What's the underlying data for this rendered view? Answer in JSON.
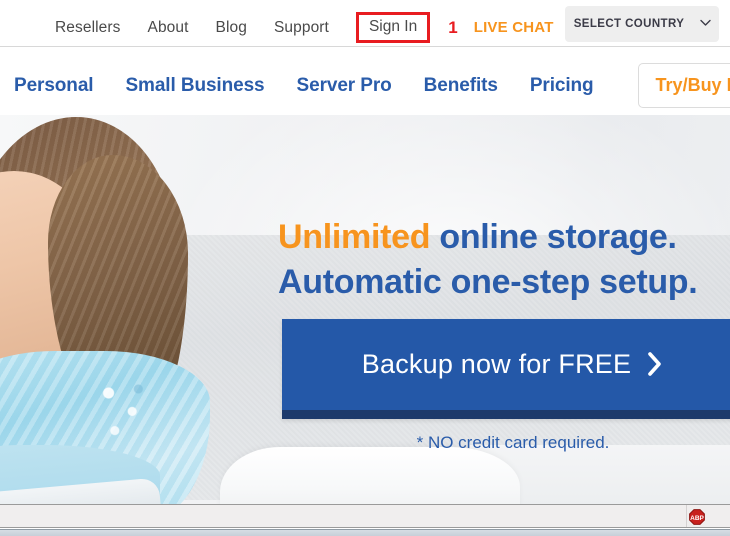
{
  "utility_bar": {
    "links": [
      {
        "label": "Resellers"
      },
      {
        "label": "About"
      },
      {
        "label": "Blog"
      },
      {
        "label": "Support"
      }
    ],
    "sign_in_label": "Sign In",
    "annotation_number": "1",
    "live_chat_label": "LIVE CHAT",
    "country_select_label": "SELECT COUNTRY",
    "annotation_color": "#e81c20",
    "live_chat_color": "#f7941e"
  },
  "main_nav": {
    "items": [
      {
        "label": "Personal"
      },
      {
        "label": "Small Business"
      },
      {
        "label": "Server Pro"
      },
      {
        "label": "Benefits"
      },
      {
        "label": "Pricing"
      }
    ],
    "cta_label": "Try/Buy Now",
    "link_color": "#2a5caa",
    "cta_color": "#f7941e"
  },
  "hero": {
    "headline_accent": "Unlimited",
    "headline_rest": " online storage.",
    "headline_line2": "Automatic one-step setup.",
    "cta_label": "Backup now for FREE",
    "cta_arrow": "chevron-right-icon",
    "note": "* NO credit card required.",
    "cta_background": "#2458a8",
    "cta_shadow": "#1d3a6b",
    "text_color": "#2a5caa",
    "accent_color": "#f7941e"
  },
  "browser": {
    "status_icon": "adblock-plus-icon"
  }
}
